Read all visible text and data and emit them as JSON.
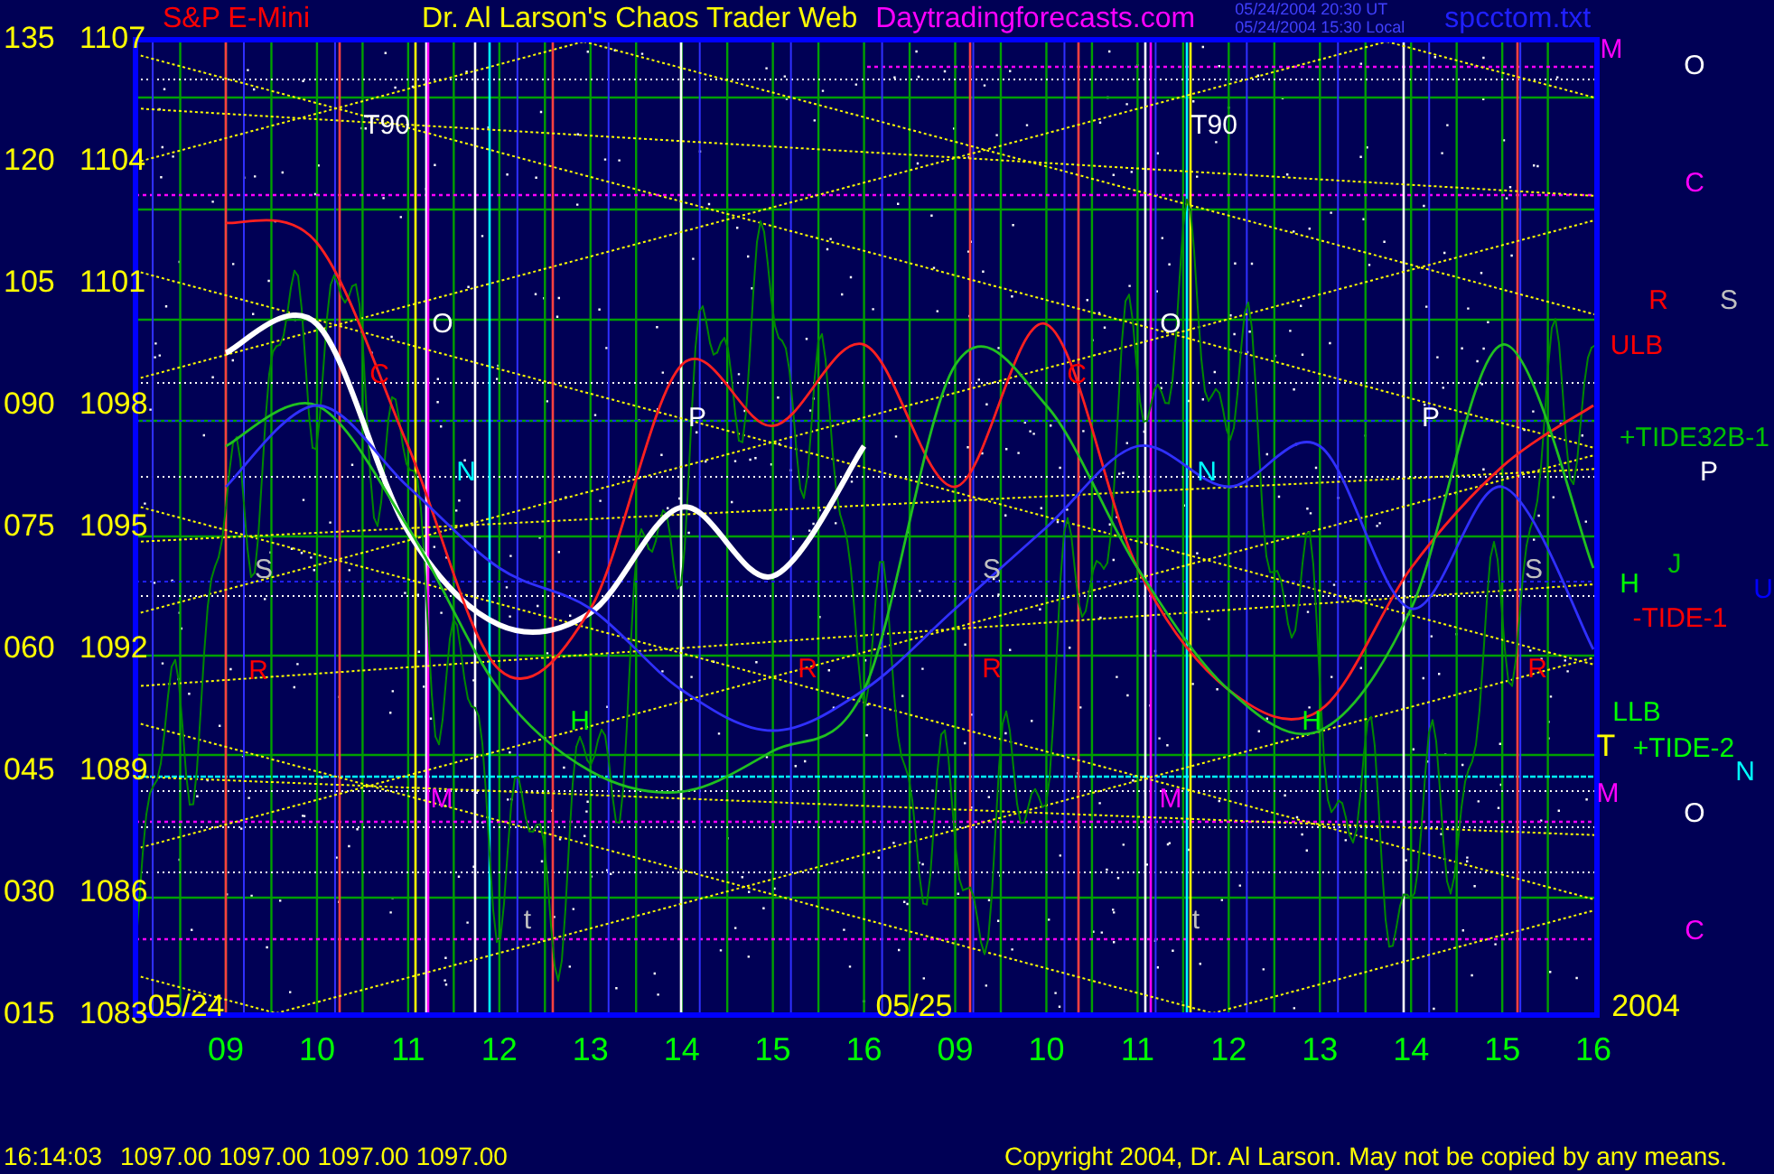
{
  "header": {
    "title": "Dr. Al Larson's Chaos Trader Web",
    "site": "Daytradingforecasts.com",
    "timestamps": [
      "05/24/2004 20:30 UT",
      "05/24/2004 15:30 Local"
    ],
    "file": "spcctom.txt"
  },
  "chart": {
    "left_scale": [
      "135",
      "120",
      "105",
      "090",
      "075",
      "060",
      "045",
      "030",
      "015"
    ],
    "chart_data": {
      "type": "line",
      "title": "S&P E-Mini",
      "grid": true,
      "categories": [
        "09",
        "10",
        "11",
        "12",
        "13",
        "14",
        "15",
        "16",
        "09",
        "10",
        "11",
        "12",
        "13",
        "14",
        "15",
        "16"
      ],
      "ylim": [
        1083,
        1107
      ],
      "yticks": [
        1107,
        1104,
        1101,
        1098,
        1095,
        1092,
        1089,
        1086,
        1083
      ],
      "series": [
        {
          "color": "#ffffff",
          "values": [
            1099.3,
            1100,
            1094.9,
            1092.6,
            1092.9,
            1095.5,
            1093.8,
            1097,
            null,
            null,
            null,
            null,
            null,
            null,
            null,
            null
          ]
        },
        {
          "color": "#ff2020",
          "values": [
            1102.5,
            1102,
            1097,
            1091.5,
            1093,
            1099,
            1097.5,
            1099.5,
            1096,
            1100,
            1094,
            1091,
            1090.5,
            1094,
            1096.5,
            1098
          ]
        },
        {
          "color": "#20c020",
          "values": [
            1097,
            1098,
            1095,
            1091,
            1089,
            1088.5,
            1089.5,
            1091,
            1099,
            1098,
            1094,
            1091,
            1090,
            1093,
            1099.5,
            1094
          ]
        },
        {
          "color": "#3030ff",
          "values": [
            1096,
            1098,
            1096,
            1094,
            1093,
            1091,
            1090,
            1091,
            1093,
            1095,
            1097,
            1096,
            1097,
            1093,
            1096,
            1092
          ]
        }
      ]
    },
    "markers": [
      {
        "text": "T90",
        "color": "#ffffff"
      },
      {
        "text": "O",
        "color": "#ffffff"
      },
      {
        "text": "C",
        "color": "#ff0000"
      },
      {
        "text": "N",
        "color": "#00ffff"
      },
      {
        "text": "S",
        "color": "#c0c0c0"
      },
      {
        "text": "R",
        "color": "#ff0000"
      },
      {
        "text": "M",
        "color": "#ff00ff"
      },
      {
        "text": "t",
        "color": "#c0c0c0"
      },
      {
        "text": "H",
        "color": "#00ff00"
      },
      {
        "text": "P",
        "color": "#ffffff"
      },
      {
        "text": "R",
        "color": "#ff0000"
      },
      {
        "text": "T90",
        "color": "#ffffff"
      },
      {
        "text": "O",
        "color": "#ffffff"
      },
      {
        "text": "C",
        "color": "#ff0000"
      },
      {
        "text": "N",
        "color": "#00ffff"
      },
      {
        "text": "S",
        "color": "#c0c0c0"
      },
      {
        "text": "R",
        "color": "#ff0000"
      },
      {
        "text": "M",
        "color": "#ff00ff"
      },
      {
        "text": "t",
        "color": "#c0c0c0"
      },
      {
        "text": "H",
        "color": "#00ff00"
      },
      {
        "text": "P",
        "color": "#ffffff"
      },
      {
        "text": "S",
        "color": "#c0c0c0"
      },
      {
        "text": "R",
        "color": "#ff0000"
      },
      {
        "text": "M",
        "color": "#ff00ff"
      },
      {
        "text": "O",
        "color": "#ffffff"
      },
      {
        "text": "C",
        "color": "#ff00ff"
      },
      {
        "text": "R",
        "color": "#ff0000"
      },
      {
        "text": "S",
        "color": "#c0c0c0"
      },
      {
        "text": "ULB",
        "color": "#ff0000"
      },
      {
        "text": "+TIDE32B-1",
        "color": "#00c000"
      },
      {
        "text": "P",
        "color": "#ffffff"
      },
      {
        "text": "J",
        "color": "#00c000"
      },
      {
        "text": "U",
        "color": "#0000ff"
      },
      {
        "text": "H",
        "color": "#00ff00"
      },
      {
        "text": "-TIDE-1",
        "color": "#ff0000"
      },
      {
        "text": "LLB",
        "color": "#00ff00"
      },
      {
        "text": "T",
        "color": "#ffff00"
      },
      {
        "text": "+TIDE-2",
        "color": "#00ff00"
      },
      {
        "text": "N",
        "color": "#00ffff"
      },
      {
        "text": "M",
        "color": "#ff00ff"
      },
      {
        "text": "O",
        "color": "#ffffff"
      },
      {
        "text": "C",
        "color": "#ff00ff"
      },
      {
        "text": "05/24",
        "color": "#ffff00"
      },
      {
        "text": "05/25",
        "color": "#ffff00"
      },
      {
        "text": "2004",
        "color": "#ffff00"
      }
    ]
  },
  "status_bar": {
    "time": "16:14:03",
    "quotes": [
      "1097.00",
      "1097.00",
      "1097.00",
      "1097.00"
    ],
    "copyright": "Copyright 2004, Dr. Al Larson. May not be copied by any means."
  }
}
